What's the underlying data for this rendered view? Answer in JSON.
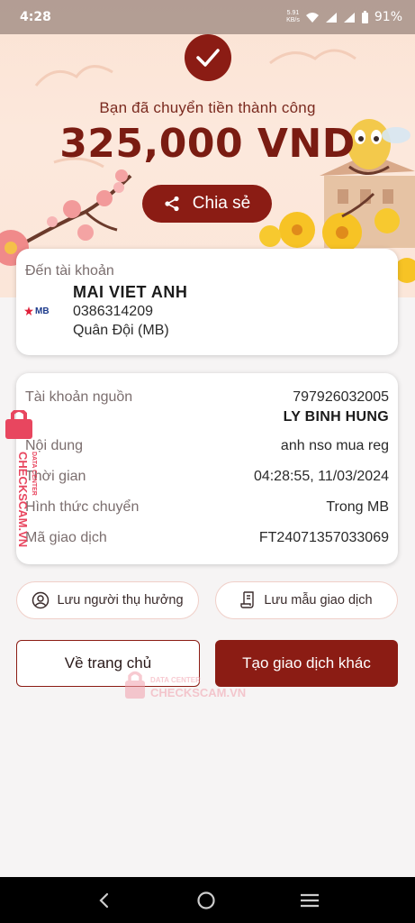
{
  "status_bar": {
    "time": "4:28",
    "net_speed": "5.91\nKB/s",
    "battery": "91%"
  },
  "hero": {
    "success_message": "Bạn đã chuyển tiền thành công",
    "amount": "325,000 VND",
    "share_label": "Chia sẻ",
    "accent_color": "#8b1c14"
  },
  "recipient": {
    "label": "Đến tài khoản",
    "bank_logo_text": "MB",
    "name": "MAI VIET ANH",
    "account_number": "0386314209",
    "bank_name": "Quân Đội (MB)"
  },
  "details": {
    "source_label": "Tài khoản nguồn",
    "source_account": "797926032005",
    "source_name": "LY BINH HUNG",
    "content_label": "Nội dung",
    "content_value": "anh nso mua reg",
    "time_label": "Thời gian",
    "time_value": "04:28:55, 11/03/2024",
    "method_label": "Hình thức chuyển",
    "method_value": "Trong MB",
    "txn_label": "Mã giao dịch",
    "txn_value": "FT24071357033069"
  },
  "actions": {
    "save_beneficiary": "Lưu người thụ hưởng",
    "save_template": "Lưu mẫu giao dịch",
    "home": "Về trang chủ",
    "new_transaction": "Tạo giao dịch khác"
  },
  "watermark": {
    "vertical_text": "CHECKSCAM.VN",
    "vertical_sub": "DATA CENTER",
    "center_sub": "DATA CENTER",
    "center_text": "CHECKSCAM.VN"
  },
  "nav": {
    "icons": [
      "back-icon",
      "home-circle-icon",
      "recents-icon"
    ]
  }
}
